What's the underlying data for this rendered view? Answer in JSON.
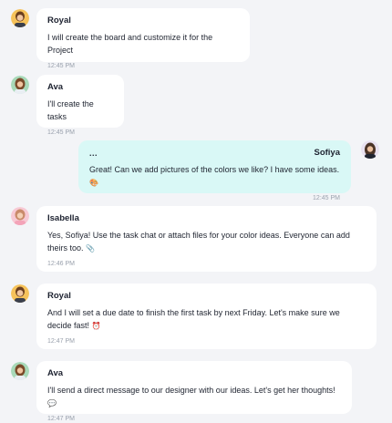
{
  "messages": [
    {
      "sender": "Royal",
      "text": "I will create the board and customize it for the Project",
      "emoji": "",
      "time": "12:45 PM",
      "avatar": "royal-avatar"
    },
    {
      "sender": "Ava",
      "text": "I'll create the tasks",
      "emoji": "",
      "time": "12:45 PM",
      "avatar": "ava-avatar"
    },
    {
      "sender": "Sofiya",
      "menu": "...",
      "text": "Great! Can we add pictures of the colors we like? I have some ideas.",
      "emoji": "🎨",
      "time": "12:45 PM",
      "avatar": "sofiya-avatar"
    },
    {
      "sender": "Isabella",
      "text": "Yes, Sofiya! Use the task chat or attach files for your color ideas. Everyone can add theirs too.",
      "emoji": "📎",
      "time": "12:46 PM",
      "avatar": "isabella-avatar"
    },
    {
      "sender": "Royal",
      "text": "And I will set a due date to finish the first task by next Friday. Let's make sure we decide fast!",
      "emoji": "⏰",
      "time": "12:47 PM",
      "avatar": "royal-avatar"
    },
    {
      "sender": "Ava",
      "text": "I'll send a direct message to our designer with our ideas. Let's get her thoughts!",
      "emoji": "💬",
      "time": "12:47 PM",
      "avatar": "ava-avatar"
    }
  ],
  "colors": {
    "background": "#f3f4f7",
    "bubble": "#ffffff",
    "own_bubble": "#d9f8f6",
    "timestamp": "#9aa1ad"
  }
}
